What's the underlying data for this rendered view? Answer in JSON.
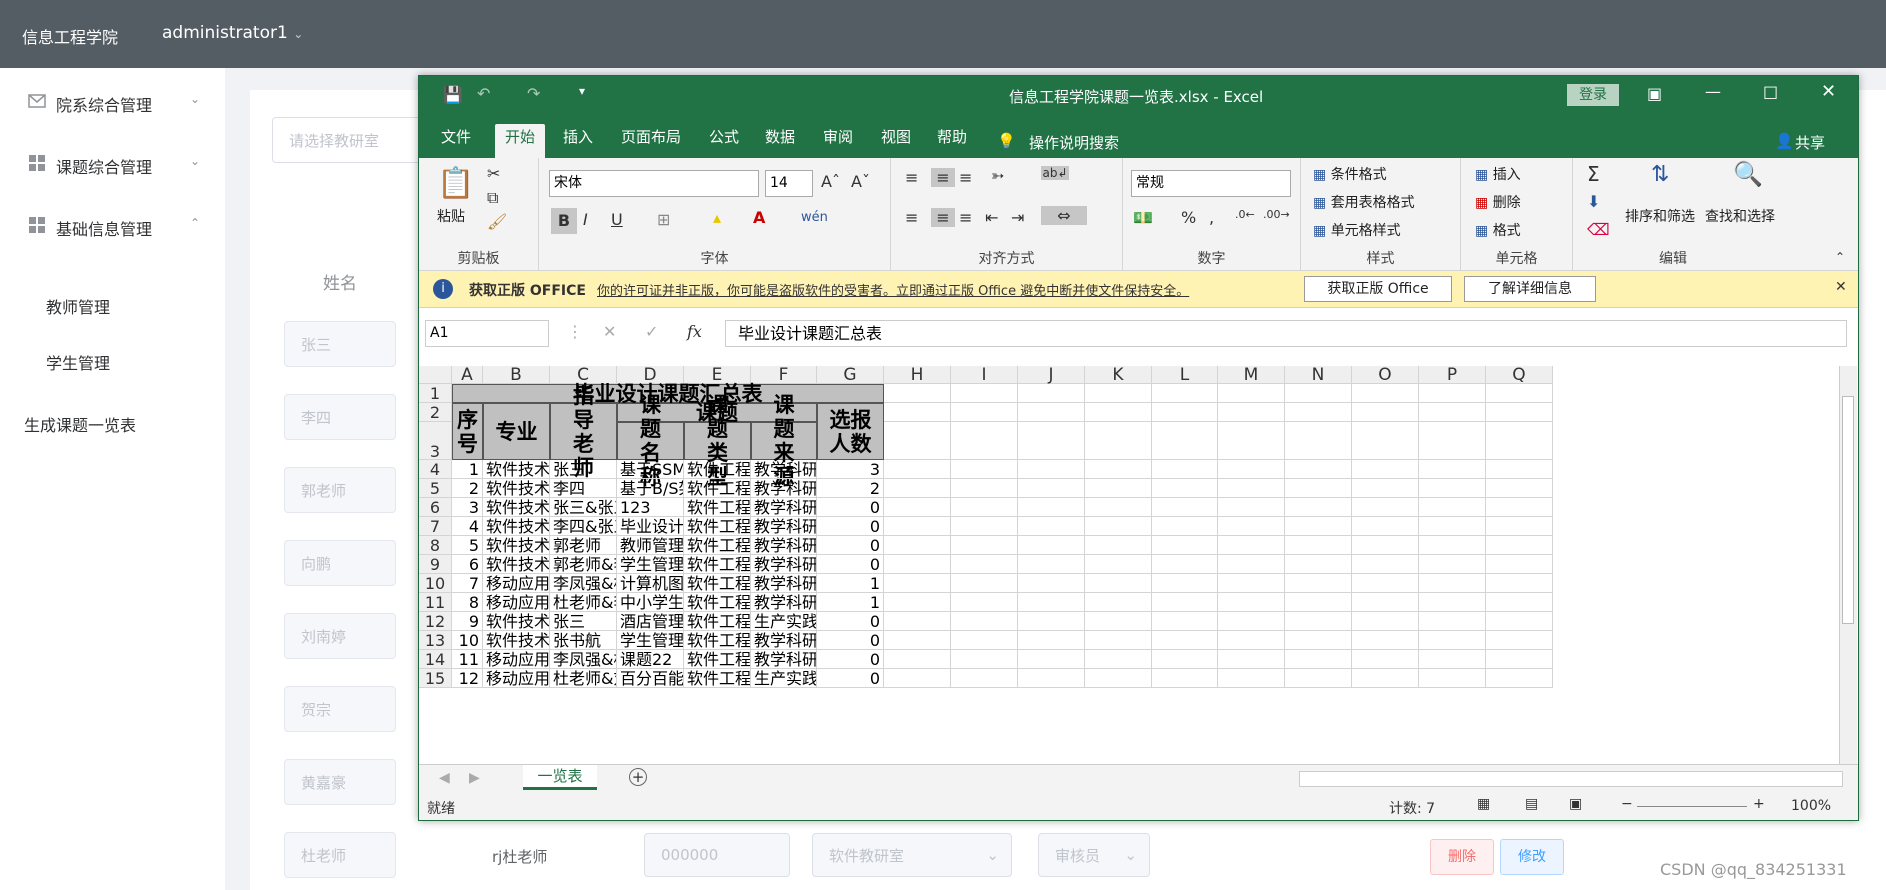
{
  "app": {
    "brand": "信息工程学院",
    "user": "administrator1"
  },
  "sidebar": {
    "menus": [
      {
        "label": "院系综合管理",
        "icon": "mail-icon"
      },
      {
        "label": "课题综合管理",
        "icon": "grid-icon"
      },
      {
        "label": "基础信息管理",
        "icon": "grid-icon"
      }
    ],
    "subitems": [
      "教师管理",
      "学生管理"
    ],
    "bottom": "生成课题一览表"
  },
  "main": {
    "select_placeholder": "请选择教研室",
    "col_name": "姓名",
    "names": [
      "张三",
      "李四",
      "郭老师",
      "向鹏",
      "刘南婷",
      "贺宗",
      "黄嘉豪",
      "杜老师"
    ],
    "foot": {
      "account": "rj杜老师",
      "phone": "000000",
      "dept": "软件教研室",
      "role": "审核员",
      "delete": "删除",
      "edit": "修改"
    }
  },
  "excel": {
    "title": "信息工程学院课题一览表.xlsx  -  Excel",
    "login": "登录",
    "tabs": [
      "文件",
      "开始",
      "插入",
      "页面布局",
      "公式",
      "数据",
      "审阅",
      "视图",
      "帮助"
    ],
    "tell_me": "操作说明搜索",
    "share": "共享",
    "ribbon": {
      "paste": "粘贴",
      "clipboard": "剪贴板",
      "font_name": "宋体",
      "font_size": "14",
      "font": "字体",
      "align": "对齐方式",
      "number_format": "常规",
      "number": "数字",
      "cond_format": "条件格式",
      "table_format": "套用表格格式",
      "cell_style": "单元格样式",
      "styles": "样式",
      "insert": "插入",
      "delete": "删除",
      "format": "格式",
      "cells": "单元格",
      "sort_filter": "排序和筛选",
      "find_select": "查找和选择",
      "editing": "编辑"
    },
    "warning": {
      "title": "获取正版 OFFICE",
      "text": "你的许可证并非正版，你可能是盗版软件的受害者。立即通过正版 Office 避免中断并使文件保持安全。",
      "btn1": "获取正版 Office",
      "btn2": "了解详细信息"
    },
    "namebox": "A1",
    "formula": "毕业设计课题汇总表",
    "columns": [
      "A",
      "B",
      "C",
      "D",
      "E",
      "F",
      "G",
      "H",
      "I",
      "J",
      "K",
      "L",
      "M",
      "N",
      "O",
      "P",
      "Q"
    ],
    "rows": [
      "1",
      "2",
      "3",
      "4",
      "5",
      "6",
      "7",
      "8",
      "9",
      "10",
      "11",
      "12",
      "13",
      "14",
      "15"
    ],
    "sheet_title": "毕业设计课题汇总表",
    "headers": {
      "seq": "序号",
      "major": "专业",
      "teacher": "指导老师",
      "topic": "课题",
      "name": "课题名称",
      "type": "课题类型",
      "source": "课题来源",
      "count": "选报人数"
    },
    "data": [
      [
        "1",
        "软件技术,",
        "张三",
        "基于SSM的",
        "软件工程",
        "教学科研",
        "3"
      ],
      [
        "2",
        "软件技术",
        "李四",
        "基于B/S架",
        "软件工程",
        "教学科研",
        "2"
      ],
      [
        "3",
        "软件技术,",
        "张三&张三",
        "123",
        "软件工程",
        "教学科研",
        "0"
      ],
      [
        "4",
        "软件技术,",
        "李四&张三",
        "毕业设计",
        "软件工程",
        "教学科研",
        "0"
      ],
      [
        "5",
        "软件技术,",
        "郭老师",
        "教师管理系",
        "软件工程",
        "教学科研",
        "0"
      ],
      [
        "6",
        "软件技术,",
        "郭老师&李",
        "学生管理系",
        "软件工程",
        "教学科研",
        "0"
      ],
      [
        "7",
        "移动应用,",
        "李凤强&杜",
        "计算机图形",
        "软件工程",
        "教学科研",
        "1"
      ],
      [
        "8",
        "移动应用,",
        "杜老师&李",
        "中小学生管",
        "软件工程",
        "教学科研",
        "1"
      ],
      [
        "9",
        "软件技术,",
        "张三",
        "酒店管理系",
        "软件工程",
        "生产实践",
        "0"
      ],
      [
        "10",
        "软件技术",
        "张书航",
        "学生管理系",
        "软件工程",
        "教学科研",
        "0"
      ],
      [
        "11",
        "移动应用,",
        "李凤强&杜",
        "课题22",
        "软件工程",
        "教学科研",
        "0"
      ],
      [
        "12",
        "移动应用,",
        "杜老师&刘",
        "百分百能力",
        "软件工程",
        "生产实践",
        "0"
      ]
    ],
    "sheet_tab": "一览表",
    "status": {
      "ready": "就绪",
      "count": "计数: 7",
      "zoom": "100%"
    }
  },
  "watermark": "CSDN @qq_834251331"
}
